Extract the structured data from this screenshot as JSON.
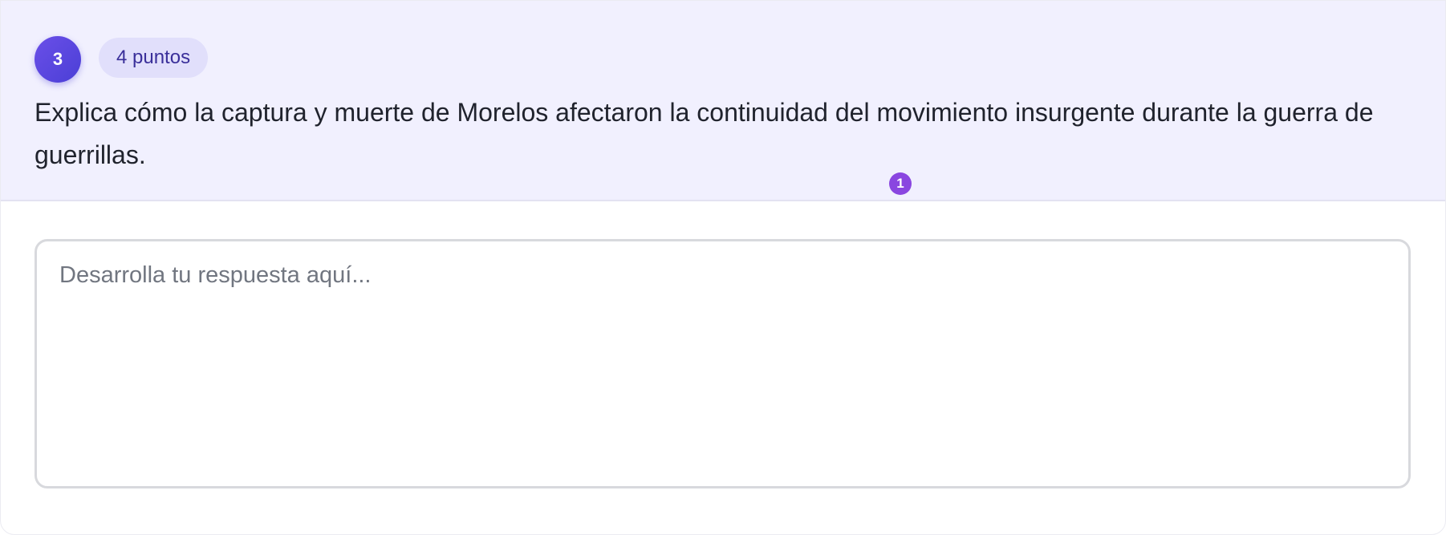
{
  "question": {
    "number": "3",
    "points": "4 puntos",
    "text": "Explica cómo la captura y muerte de Morelos afectaron la continuidad del movimiento insurgente durante la guerra de guerrillas.",
    "step_marker": "1"
  },
  "answer": {
    "value": "",
    "placeholder": "Desarrolla tu respuesta aquí..."
  },
  "colors": {
    "header_bg": "#f1f0fe",
    "badge_bg": "#4b3fd6",
    "pill_bg": "#e1dffb",
    "pill_text": "#3a2f9a",
    "marker_bg": "#8a46e0"
  }
}
